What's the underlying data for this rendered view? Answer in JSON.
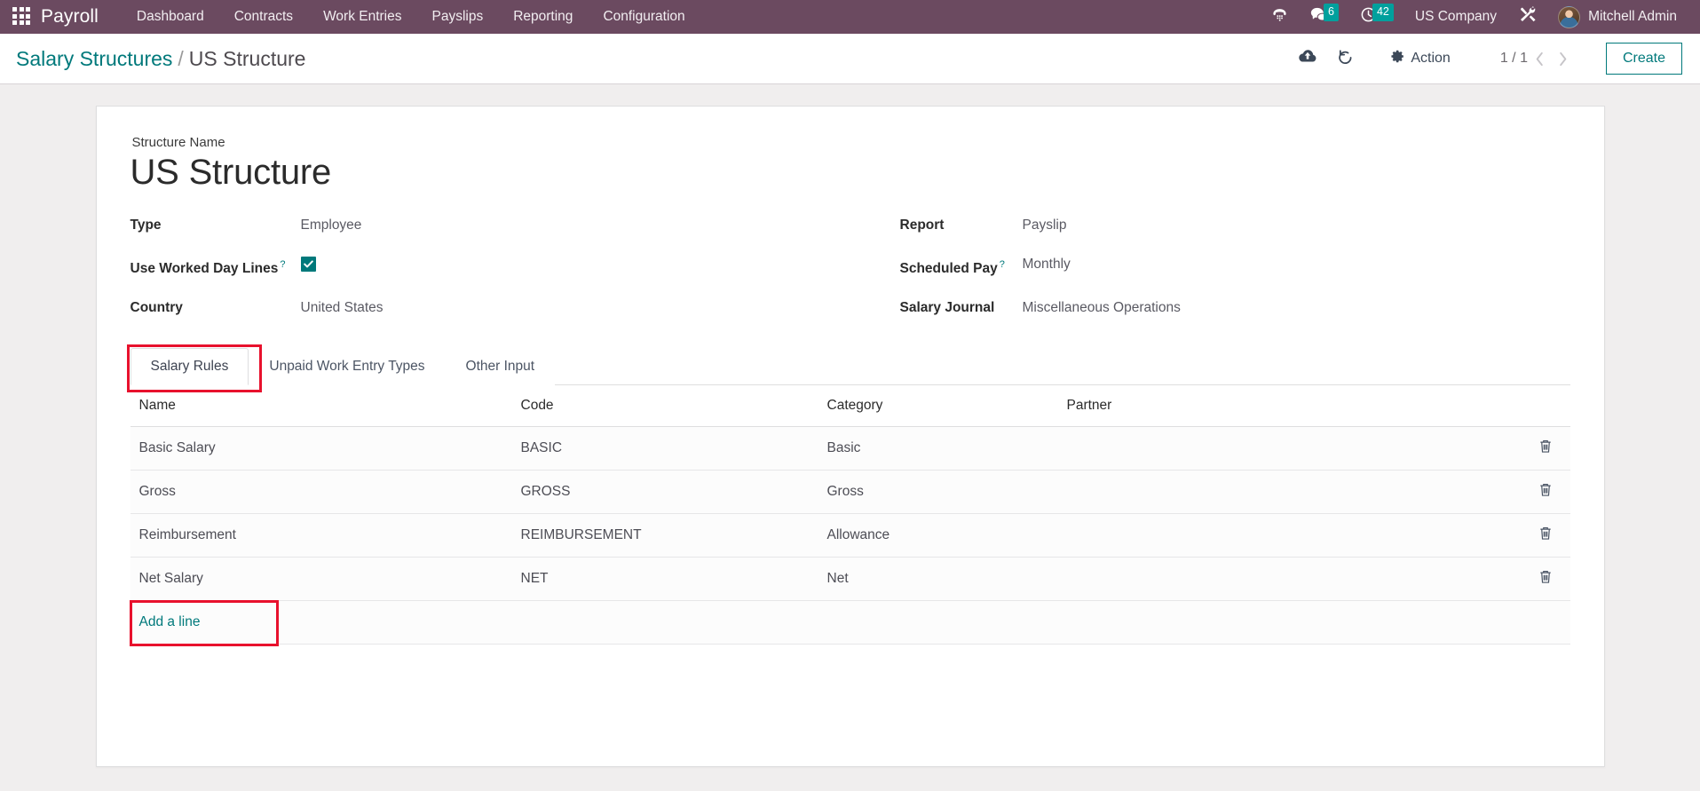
{
  "navbar": {
    "apps_icon": "apps-grid-icon",
    "brand": "Payroll",
    "menu": [
      {
        "label": "Dashboard"
      },
      {
        "label": "Contracts"
      },
      {
        "label": "Work Entries"
      },
      {
        "label": "Payslips"
      },
      {
        "label": "Reporting"
      },
      {
        "label": "Configuration"
      }
    ],
    "systray": {
      "voip_icon": "phone-dialpad-icon",
      "messages_icon": "chat-bubbles-icon",
      "messages_count": "6",
      "activities_icon": "clock-icon",
      "activities_count": "42",
      "company": "US Company",
      "tools_icon": "wrench-screwdriver-icon",
      "user": "Mitchell Admin",
      "avatar": "user-avatar"
    }
  },
  "control_panel": {
    "breadcrumb": {
      "parent": "Salary Structures",
      "separator": "/",
      "current": "US Structure"
    },
    "save_icon": "cloud-upload-icon",
    "discard_icon": "undo-arrow-icon",
    "action_icon": "gear-icon",
    "action_label": "Action",
    "pager": "1 / 1",
    "prev_icon": "chevron-left-icon",
    "next_icon": "chevron-right-icon",
    "create_label": "Create"
  },
  "form": {
    "structure_name_label": "Structure Name",
    "structure_name_value": "US Structure",
    "left_fields": [
      {
        "label": "Type",
        "value": "Employee",
        "help": false,
        "type": "text"
      },
      {
        "label": "Use Worked Day Lines",
        "value": "",
        "help": true,
        "type": "checkbox",
        "checked": true
      },
      {
        "label": "Country",
        "value": "United States",
        "help": false,
        "type": "text"
      }
    ],
    "right_fields": [
      {
        "label": "Report",
        "value": "Payslip",
        "help": false,
        "type": "text"
      },
      {
        "label": "Scheduled Pay",
        "value": "Monthly",
        "help": true,
        "type": "text"
      },
      {
        "label": "Salary Journal",
        "value": "Miscellaneous Operations",
        "help": false,
        "type": "text"
      }
    ],
    "help_marker": "?"
  },
  "notebook": {
    "tabs": [
      {
        "label": "Salary Rules",
        "active": true,
        "highlighted": true
      },
      {
        "label": "Unpaid Work Entry Types",
        "active": false,
        "highlighted": false
      },
      {
        "label": "Other Input",
        "active": false,
        "highlighted": false
      }
    ],
    "table": {
      "columns": [
        "Name",
        "Code",
        "Category",
        "Partner"
      ],
      "rows": [
        {
          "name": "Basic Salary",
          "code": "BASIC",
          "category": "Basic",
          "partner": "",
          "delete_icon": "trash-icon"
        },
        {
          "name": "Gross",
          "code": "GROSS",
          "category": "Gross",
          "partner": "",
          "delete_icon": "trash-icon"
        },
        {
          "name": "Reimbursement",
          "code": "REIMBURSEMENT",
          "category": "Allowance",
          "partner": "",
          "delete_icon": "trash-icon"
        },
        {
          "name": "Net Salary",
          "code": "NET",
          "category": "Net",
          "partner": "",
          "delete_icon": "trash-icon"
        }
      ],
      "add_line_label": "Add a line",
      "add_line_highlighted": true
    }
  },
  "colors": {
    "navbar_bg": "#6b4a60",
    "accent_teal": "#00797b",
    "badge_teal": "#00a09d",
    "annotation_red": "#e8112d",
    "page_bg": "#f0eeee"
  }
}
